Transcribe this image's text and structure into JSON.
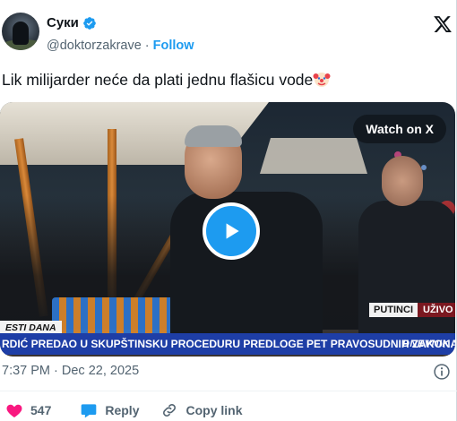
{
  "author": {
    "display_name": "Суки",
    "handle": "@doktorzakrave",
    "separator": "·",
    "follow_label": "Follow",
    "verified_color": "#1d9bf0"
  },
  "tweet": {
    "text": "Lik milijarder neće da plati jednu flašicu vode",
    "emoji": "clown-face-icon"
  },
  "media": {
    "watch_label": "Watch on X",
    "location_tag": "PUTINCI",
    "live_tag": "UŽIVO",
    "ticker_tag": "ESTI DANA",
    "ticker_text": "RDIĆ PREDAO U SKUPŠTINSKU PROCEDURU PREDLOGE PET PRAVOSUDNIH ZAKONA",
    "ticker_logo": "DNEVNIK",
    "ticker_color": "#1e3ea6"
  },
  "timestamp": "7:37 PM · Dec 22, 2025",
  "actions": {
    "like_count": "547",
    "reply_label": "Reply",
    "copy_link_label": "Copy link",
    "like_color": "#f91880",
    "reply_color": "#1d9bf0"
  }
}
